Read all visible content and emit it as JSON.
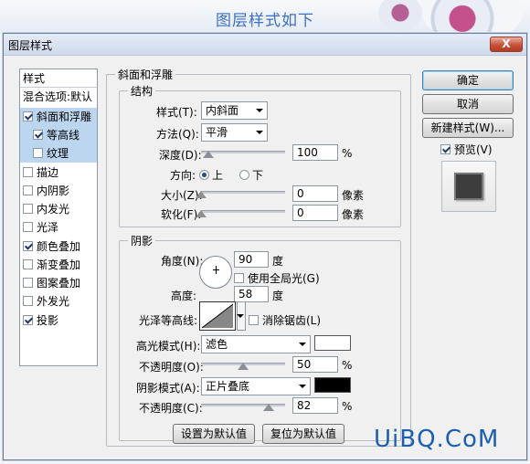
{
  "banner": "图层样式如下",
  "dialog": {
    "title": "图层样式",
    "close": "X"
  },
  "sidebar": {
    "header": "样式",
    "blend_options": "混合选项:默认",
    "items": [
      {
        "label": "斜面和浮雕",
        "checked": true
      },
      {
        "label": "等高线",
        "checked": true
      },
      {
        "label": "纹理",
        "checked": false
      },
      {
        "label": "描边",
        "checked": false
      },
      {
        "label": "内阴影",
        "checked": false
      },
      {
        "label": "内发光",
        "checked": false
      },
      {
        "label": "光泽",
        "checked": false
      },
      {
        "label": "颜色叠加",
        "checked": true
      },
      {
        "label": "渐变叠加",
        "checked": false
      },
      {
        "label": "图案叠加",
        "checked": false
      },
      {
        "label": "外发光",
        "checked": false
      },
      {
        "label": "投影",
        "checked": true
      }
    ]
  },
  "bevel": {
    "section_title": "斜面和浮雕",
    "structure_title": "结构",
    "style_label": "样式(T):",
    "style_value": "内斜面",
    "technique_label": "方法(Q):",
    "technique_value": "平滑",
    "depth_label": "深度(D):",
    "depth_value": "100",
    "depth_unit": "%",
    "direction_label": "方向:",
    "direction_up": "上",
    "direction_down": "下",
    "size_label": "大小(Z):",
    "size_value": "0",
    "size_unit": "像素",
    "soften_label": "软化(F):",
    "soften_value": "0",
    "soften_unit": "像素",
    "shading_title": "阴影",
    "angle_label": "角度(N):",
    "angle_value": "90",
    "angle_unit": "度",
    "global_light_label": "使用全局光(G)",
    "altitude_label": "高度:",
    "altitude_value": "58",
    "altitude_unit": "度",
    "gloss_label": "光泽等高线:",
    "antialias_label": "消除锯齿(L)",
    "highlight_mode_label": "高光模式(H):",
    "highlight_mode_value": "滤色",
    "highlight_color": "#ffffff",
    "highlight_opacity_label": "不透明度(O):",
    "highlight_opacity_value": "50",
    "highlight_opacity_unit": "%",
    "shadow_mode_label": "阴影模式(A):",
    "shadow_mode_value": "正片叠底",
    "shadow_color": "#000000",
    "shadow_opacity_label": "不透明度(C):",
    "shadow_opacity_value": "82",
    "shadow_opacity_unit": "%",
    "make_default": "设置为默认值",
    "reset_default": "复位为默认值"
  },
  "actions": {
    "ok": "确定",
    "cancel": "取消",
    "new_style": "新建样式(W)...",
    "preview_label": "预览(V)"
  },
  "watermark": "UiBQ.CoM"
}
